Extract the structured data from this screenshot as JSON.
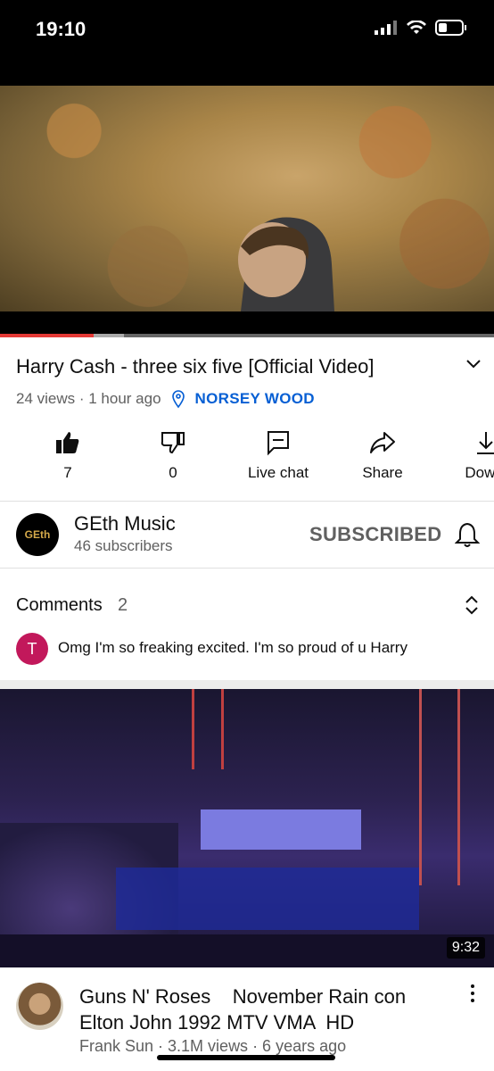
{
  "status_bar": {
    "time": "19:10"
  },
  "player": {
    "progress_fraction": 0.19,
    "buffer_fraction": 0.25
  },
  "video": {
    "title": "Harry Cash - three six five [Official Video]",
    "views": "24 views · 1 hour ago",
    "location": "NORSEY WOOD"
  },
  "actions": [
    {
      "icon": "thumbs-up-icon",
      "label": "7"
    },
    {
      "icon": "thumbs-down-icon",
      "label": "0"
    },
    {
      "icon": "live-chat-icon",
      "label": "Live chat"
    },
    {
      "icon": "share-icon",
      "label": "Share"
    },
    {
      "icon": "download-icon",
      "label": "Downl"
    }
  ],
  "channel": {
    "avatar_text": "GEth",
    "name": "GEth Music",
    "subscribers": "46 subscribers",
    "subscribe_label": "SUBSCRIBED"
  },
  "comments": {
    "heading": "Comments",
    "count": "2",
    "top_comment_initial": "T",
    "top_comment_text": "Omg I'm so freaking excited. I'm so proud of u Harry"
  },
  "next_video": {
    "duration": "9:32",
    "title": "Guns N' Roses    November Rain con\nElton John 1992 MTV VMA  HD",
    "meta": "Frank Sun · 3.1M views · 6 years ago"
  }
}
